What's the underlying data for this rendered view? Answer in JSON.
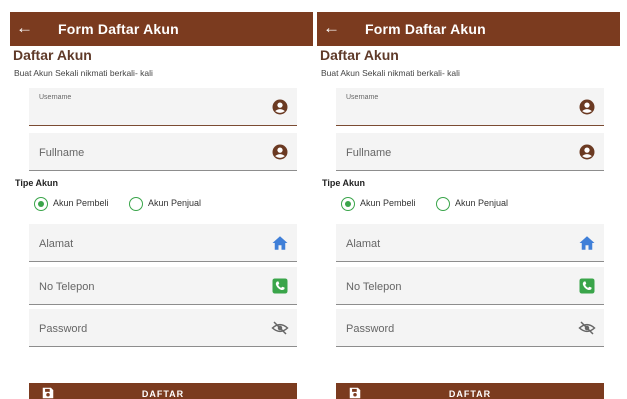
{
  "panels": [
    {
      "appbar": {
        "back_icon": "arrow-left-icon",
        "title": "Form Daftar Akun"
      },
      "heading": "Daftar Akun",
      "subtitle": "Buat Akun Sekali nikmati berkali- kali",
      "username": {
        "label": "Username",
        "value": "",
        "icon": "account-circle-icon"
      },
      "fullname": {
        "placeholder": "Fullname",
        "icon": "account-circle-icon"
      },
      "account_type": {
        "label": "Tipe Akun",
        "options": [
          {
            "label": "Akun Pembeli",
            "selected": true
          },
          {
            "label": "Akun Penjual",
            "selected": false
          }
        ]
      },
      "alamat": {
        "placeholder": "Alamat",
        "icon": "home-icon"
      },
      "telepon": {
        "placeholder": "No Telepon",
        "icon": "phone-icon"
      },
      "password": {
        "placeholder": "Password",
        "icon": "eye-off-icon"
      },
      "submit": {
        "label": "DAFTAR",
        "icon": "save-icon"
      }
    },
    {
      "appbar": {
        "back_icon": "arrow-left-icon",
        "title": "Form Daftar Akun"
      },
      "heading": "Daftar Akun",
      "subtitle": "Buat Akun Sekali nikmati berkali- kali",
      "username": {
        "label": "Username",
        "value": "",
        "icon": "account-circle-icon"
      },
      "fullname": {
        "placeholder": "Fullname",
        "icon": "account-circle-icon"
      },
      "account_type": {
        "label": "Tipe Akun",
        "options": [
          {
            "label": "Akun Pembeli",
            "selected": true
          },
          {
            "label": "Akun Penjual",
            "selected": false
          }
        ]
      },
      "alamat": {
        "placeholder": "Alamat",
        "icon": "home-icon"
      },
      "telepon": {
        "placeholder": "No Telepon",
        "icon": "phone-icon"
      },
      "password": {
        "placeholder": "Password",
        "icon": "eye-off-icon"
      },
      "submit": {
        "label": "DAFTAR",
        "icon": "save-icon"
      }
    }
  ],
  "colors": {
    "appbar": "#7b3b1f",
    "heading": "#5f3a29",
    "radio_accent": "#3aa54a",
    "phone_icon": "#3aa54a",
    "home_icon": "#3f7fd8",
    "user_icon": "#6b3a22"
  }
}
